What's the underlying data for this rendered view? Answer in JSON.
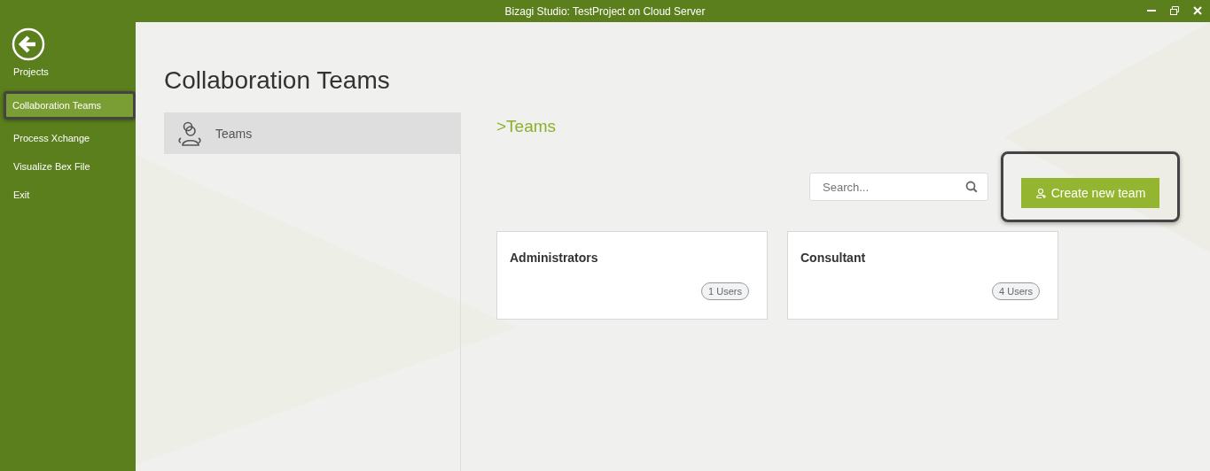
{
  "window": {
    "title": "Bizagi Studio: TestProject  on Cloud Server"
  },
  "sidebar": {
    "items": [
      {
        "label": "Projects",
        "selected": false
      },
      {
        "label": "Collaboration Teams",
        "selected": true
      },
      {
        "label": "Process Xchange",
        "selected": false
      },
      {
        "label": "Visualize Bex File",
        "selected": false
      },
      {
        "label": "Exit",
        "selected": false
      }
    ]
  },
  "page": {
    "title": "Collaboration Teams"
  },
  "nav": {
    "items": [
      {
        "label": "Teams",
        "selected": true
      }
    ]
  },
  "section": {
    "breadcrumb": ">Teams"
  },
  "search": {
    "placeholder": "Search..."
  },
  "create_button": {
    "label": "Create new team",
    "highlighted": true
  },
  "teams": [
    {
      "name": "Administrators",
      "users": "1 Users"
    },
    {
      "name": "Consultant",
      "users": "4 Users"
    }
  ]
}
